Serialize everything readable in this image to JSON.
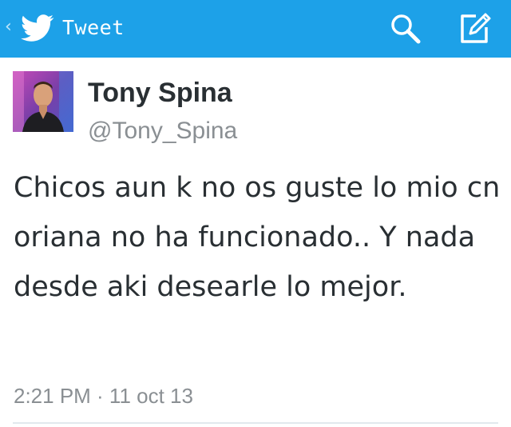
{
  "header": {
    "title": "Tweet",
    "back_icon": "back-chevron-icon",
    "logo_icon": "twitter-bird-icon",
    "search_icon": "search-icon",
    "compose_icon": "compose-icon",
    "bar_color": "#1da1e8"
  },
  "tweet": {
    "author_name": "Tony Spina",
    "author_handle": "@Tony_Spina",
    "text": "Chicos aun k no os guste lo mio cn oriana no ha funcionado.. Y nada desde aki desearle lo mejor.",
    "timestamp": "2:21 PM · 11 oct 13"
  },
  "colors": {
    "text_primary": "#292f33",
    "text_secondary": "#8a8f93",
    "divider": "#e1e8ed"
  }
}
